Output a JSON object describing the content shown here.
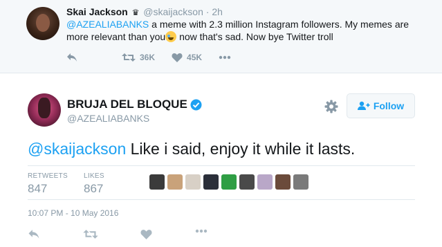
{
  "parent_tweet": {
    "name": "Skai Jackson",
    "badge": "♛",
    "handle": "@skaijackson",
    "dot": "·",
    "time": "2h",
    "mention": "@AZEALIABANKS",
    "text_part1": " a meme with 2.3 million Instagram followers. My memes are more relevant than you",
    "text_part2": " now that's sad. Now bye Twitter troll",
    "retweets": "36K",
    "likes": "45K"
  },
  "main_tweet": {
    "name": "BRUJA DEL BLOQUE",
    "handle": "@AZEALIABANKS",
    "follow_label": "Follow",
    "mention": "@skaijackson",
    "text": " Like i said, enjoy it while it lasts.",
    "retweets_label": "RETWEETS",
    "retweets_count": "847",
    "likes_label": "LIKES",
    "likes_count": "867",
    "timestamp": "10:07 PM - 10 May 2016"
  },
  "liker_avatars": [
    {
      "color": "#3b3b3b"
    },
    {
      "color": "#c9a27a"
    },
    {
      "color": "#d8d0c6"
    },
    {
      "color": "#2b2f3a"
    },
    {
      "color": "#2f9e44"
    },
    {
      "color": "#4a4a4a"
    },
    {
      "color": "#b9a7c8"
    },
    {
      "color": "#6b4b3b"
    },
    {
      "color": "#7a7a7a"
    }
  ],
  "colors": {
    "accent": "#1da1f2",
    "muted": "#8899a6",
    "parent_bg": "#f5f8fa"
  }
}
